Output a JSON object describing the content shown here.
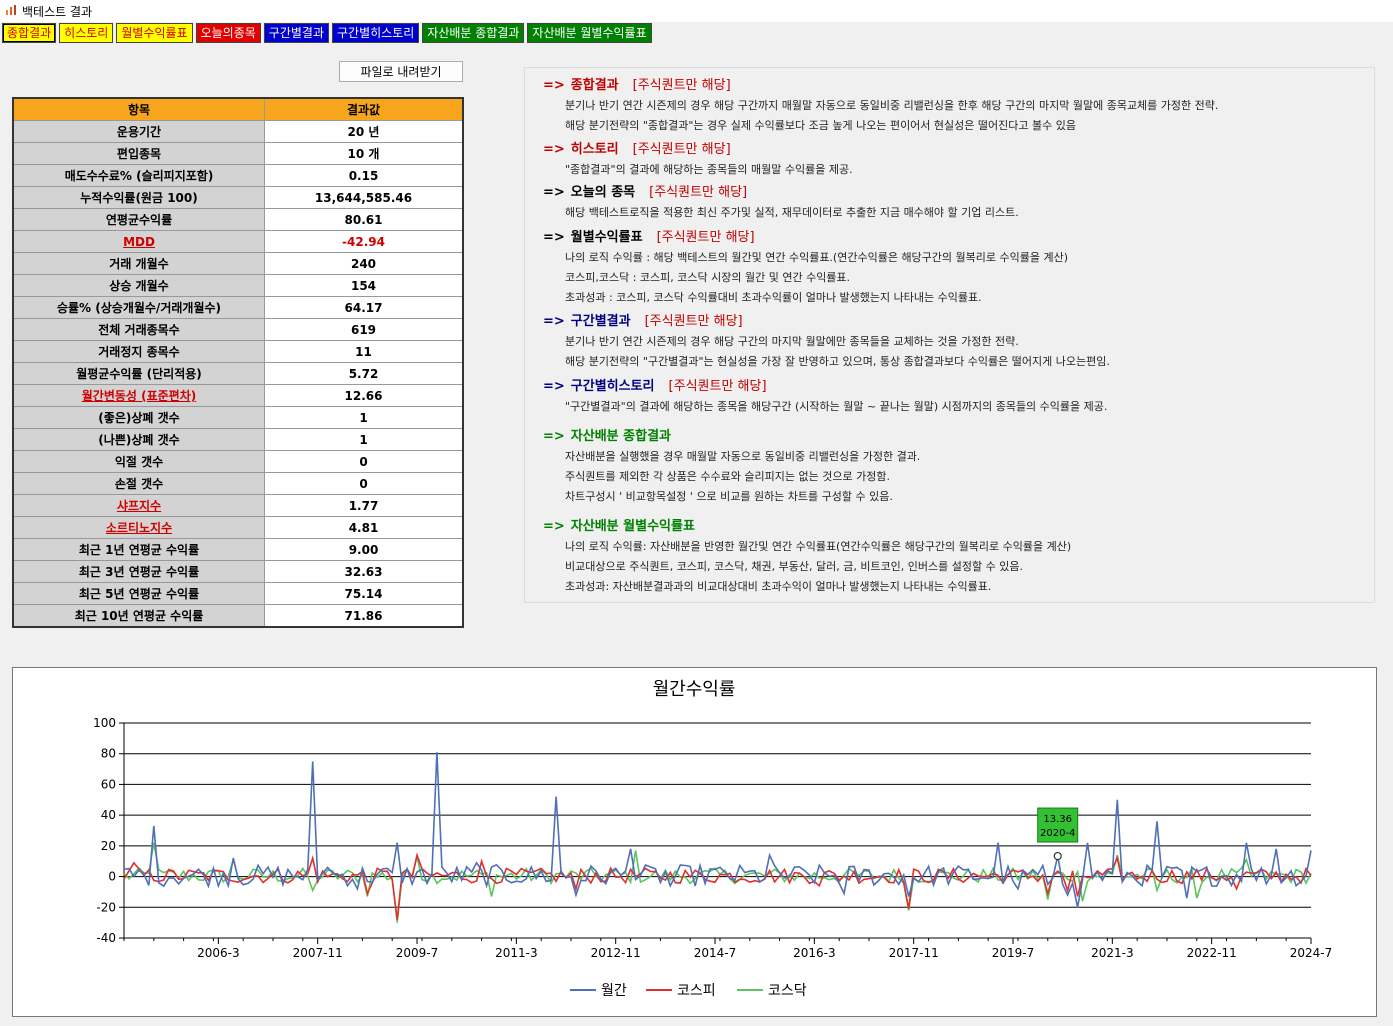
{
  "window": {
    "title": "백테스트 결과"
  },
  "tabs": [
    {
      "label": "종합결과",
      "bg": "#ffff00",
      "fg": "#d00000"
    },
    {
      "label": "히스토리",
      "bg": "#ffff00",
      "fg": "#d00000"
    },
    {
      "label": "월별수익률표",
      "bg": "#ffff00",
      "fg": "#d00000"
    },
    {
      "label": "오늘의종목",
      "bg": "#e00000",
      "fg": "#ffffff"
    },
    {
      "label": "구간별결과",
      "bg": "#0000cc",
      "fg": "#ffffff"
    },
    {
      "label": "구간별히스토리",
      "bg": "#0000cc",
      "fg": "#ffffff"
    },
    {
      "label": "자산배분 종합결과",
      "bg": "#008000",
      "fg": "#ffffff"
    },
    {
      "label": "자산배분 월별수익률표",
      "bg": "#008000",
      "fg": "#ffffff"
    }
  ],
  "download_label": "파일로 내려받기",
  "table": {
    "header_item": "항목",
    "header_value": "결과값",
    "rows": [
      {
        "k": "운용기간",
        "v": "20 년"
      },
      {
        "k": "편입종목",
        "v": "10 개"
      },
      {
        "k": "매도수수료% (슬리피지포함)",
        "v": "0.15"
      },
      {
        "k": "누적수익률(원금 100)",
        "v": "13,644,585.46"
      },
      {
        "k": "연평균수익률",
        "v": "80.61"
      },
      {
        "k": "MDD",
        "v": "-42.94",
        "red": true
      },
      {
        "k": "거래 개월수",
        "v": "240"
      },
      {
        "k": "상승 개월수",
        "v": "154"
      },
      {
        "k": "승률% (상승개월수/거래개월수)",
        "v": "64.17"
      },
      {
        "k": "전체 거래종목수",
        "v": "619"
      },
      {
        "k": "거래정지 종목수",
        "v": "11"
      },
      {
        "k": "월평균수익률 (단리적용)",
        "v": "5.72"
      },
      {
        "k": "월간변동성 (표준편차)",
        "v": "12.66",
        "redk": true
      },
      {
        "k": "(좋은)상폐 갯수",
        "v": "1"
      },
      {
        "k": "(나쁜)상폐 갯수",
        "v": "1"
      },
      {
        "k": "익절 갯수",
        "v": "0"
      },
      {
        "k": "손절 갯수",
        "v": "0"
      },
      {
        "k": "샤프지수",
        "v": "1.77",
        "redk": true
      },
      {
        "k": "소르티노지수",
        "v": "4.81",
        "redk": true
      },
      {
        "k": "최근 1년 연평균 수익률",
        "v": "9.00"
      },
      {
        "k": "최근 3년 연평균 수익률",
        "v": "32.63"
      },
      {
        "k": "최근 5년 연평균 수익률",
        "v": "75.14"
      },
      {
        "k": "최근 10년 연평균 수익률",
        "v": "71.86"
      }
    ]
  },
  "descriptions": [
    {
      "arrow": "=>",
      "title": "종합결과",
      "color": "#c00000",
      "note": "[주식퀀트만 해당]",
      "lines": [
        "분기나 반기 연간 시즌제의 경우 해당 구간까지 매월말 자동으로 동일비중 리밸런싱을 한후 해당 구간의 마지막 월말에 종목교체를 가정한 전략.",
        "해당 분기전략의 \"종합결과\"는 경우 실제 수익률보다 조금 높게 나오는 편이어서 현실성은 떨어진다고 볼수 있음"
      ]
    },
    {
      "arrow": "=>",
      "title": "히스토리",
      "color": "#c00000",
      "note": "[주식퀀트만 해당]",
      "lines": [
        "\"종합결과\"의 결과에 해당하는 종목들의 매월말 수익률을 제공."
      ]
    },
    {
      "arrow": "=>",
      "title": "오늘의 종목",
      "color": "#000000",
      "note": "[주식퀀트만 해당]",
      "lines": [
        "해당 백테스트로직을 적용한 최신 주가및 실적, 재무데이터로 추출한 지금 매수해야 할 기업 리스트."
      ]
    },
    {
      "arrow": "=>",
      "title": "월별수익률표",
      "color": "#000000",
      "note": "[주식퀀트만 해당]",
      "lines": [
        "나의 로직 수익률 : 해당 백테스트의 월간및 연간 수익률표.(연간수익률은 해당구간의 월복리로 수익률을 계산)",
        "코스피,코스닥 : 코스피, 코스닥 시장의 월간 및 연간 수익률표.",
        "초과성과 : 코스피, 코스닥 수익률대비 초과수익률이 얼마나 발생했는지 나타내는 수익률표."
      ]
    },
    {
      "arrow": "=>",
      "title": "구간별결과",
      "color": "#000080",
      "note": "[주식퀀트만 해당]",
      "lines": [
        "분기나 반기 연간 시즌제의 경우 해당 구간의 마지막 월말에만 종목들을 교체하는 것을 가정한 전략.",
        "해당 분기전략의 \"구간별결과\"는 현실성을 가장 잘 반영하고 있으며, 통상 종합결과보다 수익률은 떨어지게 나오는편임."
      ]
    },
    {
      "arrow": "=>",
      "title": "구간별히스토리",
      "color": "#000080",
      "note": "[주식퀀트만 해당]",
      "lines": [
        "\"구간별결과\"의 결과에 해당하는 종목을 해당구간 (시작하는 월말 ~ 끝나는 월말) 시점까지의 종목들의 수익률을 제공."
      ]
    },
    {
      "arrow": "=>",
      "title": "자산배분 종합결과",
      "color": "#008000",
      "note": "",
      "lines": [
        "자산배분을 실행했을 경우 매월말 자동으로 동일비중 리밸런싱을 가정한 결과.",
        "주식퀀트를 제외한 각 상품은 수수료와 슬리피지는 없는 것으로 가정함.",
        "차트구성시 ' 비교항목설정 ' 으로 비교를 원하는 차트를 구성할 수 있음."
      ]
    },
    {
      "arrow": "=>",
      "title": "자산배분 월별수익률표",
      "color": "#008000",
      "note": "",
      "lines": [
        "나의 로직 수익률: 자산배분을 반영한 월간및 연간 수익률표(연간수익률은 해당구간의 월복리로 수익률을 계산)",
        "비교대상으로 주식퀀트, 코스피, 코스닥, 채권, 부동산, 달러, 금, 비트코인, 인버스를 설정할 수 있음.",
        "초과성과: 자산배분결과과의 비교대상대비 초과수익이 얼마나 발생했는지 나타내는 수익률표."
      ]
    }
  ],
  "chart_data": {
    "type": "line",
    "title": "월간수익률",
    "ylim": [
      -40,
      100
    ],
    "yticks": [
      -40,
      -20,
      0,
      20,
      40,
      60,
      80,
      100
    ],
    "x_tick_labels": [
      "2006-3",
      "2007-11",
      "2009-7",
      "2011-3",
      "2012-11",
      "2014-7",
      "2016-3",
      "2017-11",
      "2019-7",
      "2021-3",
      "2022-11",
      "2024-7"
    ],
    "x_range": [
      "2004-8",
      "2024-7"
    ],
    "grid": "horizontal",
    "legend_position": "bottom-center",
    "tooltip": {
      "value": "13.36",
      "label": "2020-4",
      "x": "2020-4",
      "y": 13.36
    },
    "series": [
      {
        "name": "월간",
        "color": "#4f6fb8",
        "spikes": [
          [
            6,
            33
          ],
          [
            22,
            12
          ],
          [
            38,
            75
          ],
          [
            41,
            6
          ],
          [
            47,
            -8
          ],
          [
            55,
            22
          ],
          [
            63,
            81
          ],
          [
            71,
            9
          ],
          [
            79,
            -3
          ],
          [
            87,
            52
          ],
          [
            91,
            -12
          ],
          [
            102,
            18
          ],
          [
            110,
            -6
          ],
          [
            118,
            5
          ],
          [
            130,
            14
          ],
          [
            145,
            -11
          ],
          [
            158,
            -13
          ],
          [
            176,
            22
          ],
          [
            180,
            -8
          ],
          [
            186,
            -5
          ],
          [
            190,
            -12
          ],
          [
            192,
            -20
          ],
          [
            194,
            22
          ],
          [
            200,
            50
          ],
          [
            208,
            36
          ],
          [
            214,
            -14
          ],
          [
            226,
            22
          ],
          [
            232,
            18
          ],
          [
            239,
            17
          ]
        ]
      },
      {
        "name": "코스피",
        "color": "#e03030",
        "spikes": [
          [
            2,
            9
          ],
          [
            38,
            12
          ],
          [
            49,
            -11
          ],
          [
            55,
            -28
          ],
          [
            59,
            14
          ],
          [
            72,
            10
          ],
          [
            91,
            -8
          ],
          [
            140,
            -6
          ],
          [
            158,
            -21
          ],
          [
            186,
            -11
          ],
          [
            190,
            -9
          ],
          [
            192,
            -13
          ],
          [
            200,
            12
          ],
          [
            224,
            -8
          ]
        ]
      },
      {
        "name": "코스닥",
        "color": "#5cc45c",
        "spikes": [
          [
            6,
            22
          ],
          [
            22,
            11
          ],
          [
            38,
            -9
          ],
          [
            49,
            -13
          ],
          [
            55,
            -30
          ],
          [
            59,
            13
          ],
          [
            74,
            -13
          ],
          [
            103,
            17
          ],
          [
            158,
            -22
          ],
          [
            186,
            -15
          ],
          [
            193,
            -16
          ],
          [
            200,
            14
          ],
          [
            208,
            -9
          ],
          [
            216,
            -14
          ],
          [
            226,
            11
          ]
        ]
      }
    ]
  }
}
